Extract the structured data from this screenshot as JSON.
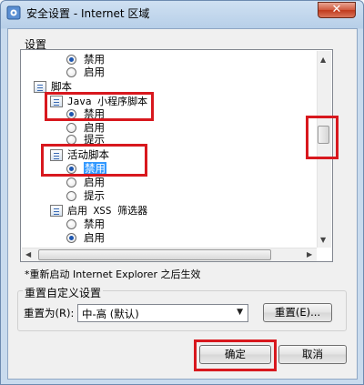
{
  "window": {
    "title": "安全设置 - Internet 区域",
    "close_label": "✕"
  },
  "settings": {
    "group_label": "设置",
    "items": [
      {
        "label": "禁用",
        "checked": true
      },
      {
        "label": "启用",
        "checked": false
      },
      {
        "label": "脚本"
      },
      {
        "label": "Java 小程序脚本"
      },
      {
        "label": "禁用",
        "checked": true
      },
      {
        "label": "启用",
        "checked": false
      },
      {
        "label": "提示",
        "checked": false
      },
      {
        "label": "活动脚本"
      },
      {
        "label": "禁用",
        "checked": true
      },
      {
        "label": "启用",
        "checked": false
      },
      {
        "label": "提示",
        "checked": false
      },
      {
        "label": "启用 XSS 筛选器"
      },
      {
        "label": "禁用",
        "checked": false
      },
      {
        "label": "启用",
        "checked": true
      }
    ]
  },
  "restart_note": "*重新启动 Internet Explorer 之后生效",
  "reset": {
    "group_label": "重置自定义设置",
    "reset_to_label": "重置为(R):",
    "selected_value": "中-高 (默认)",
    "reset_button": "重置(E)..."
  },
  "buttons": {
    "ok": "确定",
    "cancel": "取消"
  },
  "colors": {
    "highlight_box": "#d8181e",
    "selection": "#3399ff"
  },
  "icons": {
    "title": "shield-gear-icon",
    "category": "script-category-icon"
  }
}
